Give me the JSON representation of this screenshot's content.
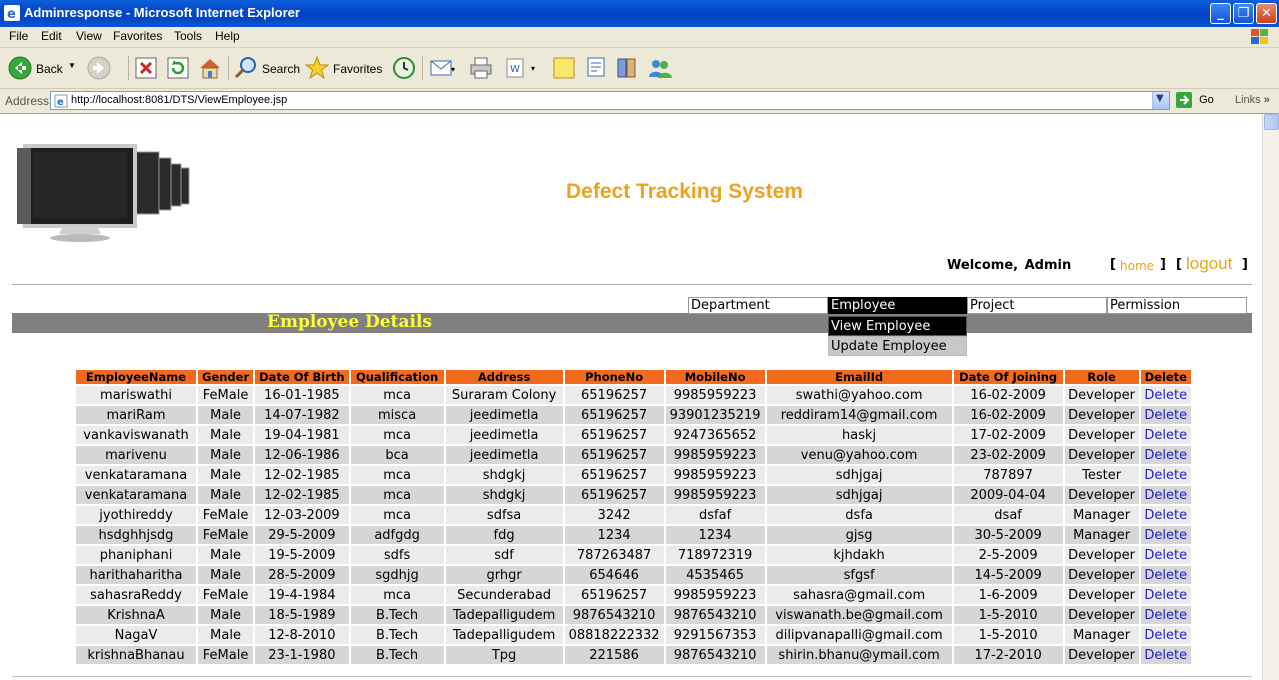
{
  "window": {
    "title": "Adminresponse - Microsoft Internet Explorer"
  },
  "menubar": [
    "File",
    "Edit",
    "View",
    "Favorites",
    "Tools",
    "Help"
  ],
  "toolbar": {
    "back": "Back",
    "search": "Search",
    "favorites": "Favorites"
  },
  "address": {
    "label": "Address",
    "url": "http://localhost:8081/DTS/ViewEmployee.jsp",
    "go": "Go",
    "links": "Links"
  },
  "page": {
    "site_title": "Defect Tracking System",
    "welcome": "Welcome,  Admin",
    "home": "home",
    "logout": "logout",
    "section_title": "Employee Details",
    "nav": [
      "Department",
      "Employee",
      "Project",
      "Permission"
    ],
    "submenu": [
      "View Employee",
      "Update Employee"
    ]
  },
  "table": {
    "headers": [
      "EmployeeName",
      "Gender",
      "Date Of Birth",
      "Qualification",
      "Address",
      "PhoneNo",
      "MobileNo",
      "EmailId",
      "Date Of Joining",
      "Role",
      "Delete"
    ],
    "rows": [
      [
        "mariswathi",
        "FeMale",
        "16-01-1985",
        "mca",
        "Suraram Colony",
        "65196257",
        "9985959223",
        "swathi@yahoo.com",
        "16-02-2009",
        "Developer",
        "Delete"
      ],
      [
        "mariRam",
        "Male",
        "14-07-1982",
        "misca",
        "jeedimetla",
        "65196257",
        "93901235219",
        "reddiram14@gmail.com",
        "16-02-2009",
        "Developer",
        "Delete"
      ],
      [
        "vankaviswanath",
        "Male",
        "19-04-1981",
        "mca",
        "jeedimetla",
        "65196257",
        "9247365652",
        "haskj",
        "17-02-2009",
        "Developer",
        "Delete"
      ],
      [
        "marivenu",
        "Male",
        "12-06-1986",
        "bca",
        "jeedimetla",
        "65196257",
        "9985959223",
        "venu@yahoo.com",
        "23-02-2009",
        "Developer",
        "Delete"
      ],
      [
        "venkataramana",
        "Male",
        "12-02-1985",
        "mca",
        "shdgkj",
        "65196257",
        "9985959223",
        "sdhjgaj",
        "787897",
        "Tester",
        "Delete"
      ],
      [
        "venkataramana",
        "Male",
        "12-02-1985",
        "mca",
        "shdgkj",
        "65196257",
        "9985959223",
        "sdhjgaj",
        "2009-04-04",
        "Developer",
        "Delete"
      ],
      [
        "jyothireddy",
        "FeMale",
        "12-03-2009",
        "mca",
        "sdfsa",
        "3242",
        "dsfaf",
        "dsfa",
        "dsaf",
        "Manager",
        "Delete"
      ],
      [
        "hsdghhjsdg",
        "FeMale",
        "29-5-2009",
        "adfgdg",
        "fdg",
        "1234",
        "1234",
        "gjsg",
        "30-5-2009",
        "Manager",
        "Delete"
      ],
      [
        "phaniphani",
        "Male",
        "19-5-2009",
        "sdfs",
        "sdf",
        "787263487",
        "718972319",
        "kjhdakh",
        "2-5-2009",
        "Developer",
        "Delete"
      ],
      [
        "harithaharitha",
        "Male",
        "28-5-2009",
        "sgdhjg",
        "grhgr",
        "654646",
        "4535465",
        "sfgsf",
        "14-5-2009",
        "Developer",
        "Delete"
      ],
      [
        "sahasraReddy",
        "FeMale",
        "19-4-1984",
        "mca",
        "Secunderabad",
        "65196257",
        "9985959223",
        "sahasra@gmail.com",
        "1-6-2009",
        "Developer",
        "Delete"
      ],
      [
        "KrishnaA",
        "Male",
        "18-5-1989",
        "B.Tech",
        "Tadepalligudem",
        "9876543210",
        "9876543210",
        "viswanath.be@gmail.com",
        "1-5-2010",
        "Developer",
        "Delete"
      ],
      [
        "NagaV",
        "Male",
        "12-8-2010",
        "B.Tech",
        "Tadepalligudem",
        "08818222332",
        "9291567353",
        "dilipvanapalli@gmail.com",
        "1-5-2010",
        "Manager",
        "Delete"
      ],
      [
        "krishnaBhanau",
        "FeMale",
        "23-1-1980",
        "B.Tech",
        "Tpg",
        "221586",
        "9876543210",
        "shirin.bhanu@ymail.com",
        "17-2-2010",
        "Developer",
        "Delete"
      ]
    ]
  },
  "colors": {
    "accent_orange": "#eda21d",
    "header_orange": "#f26a1b",
    "section_yellow": "#ffff33",
    "link_blue": "#1f1fbf"
  }
}
